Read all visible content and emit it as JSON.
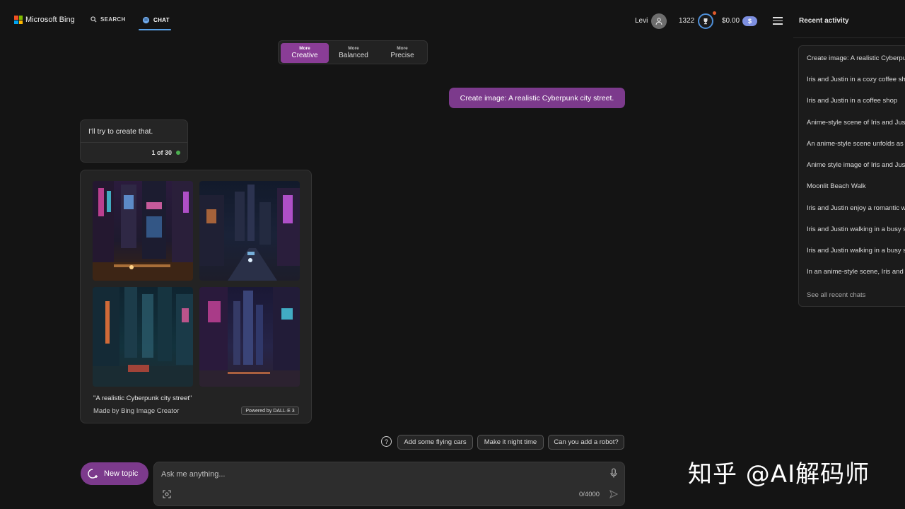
{
  "header": {
    "brand": "Microsoft Bing",
    "nav": [
      {
        "label": "SEARCH",
        "icon": "search-icon"
      },
      {
        "label": "CHAT",
        "icon": "chat-icon"
      }
    ],
    "user_name": "Levi",
    "points": "1322",
    "balance": "$0.00",
    "balance_badge": "$"
  },
  "recent": {
    "title": "Recent activity",
    "items": [
      "Create image: A realistic Cyberpunk city street.",
      "Iris and Justin in a cozy coffee shop",
      "Iris and Justin in a coffee shop",
      "Anime-style scene of Iris and Justin",
      "An anime-style scene unfolds as",
      "Anime style image of Iris and Justin",
      "Moonlit Beach Walk",
      "Iris and Justin enjoy a romantic walk",
      "Iris and Justin walking in a busy street",
      "Iris and Justin walking in a busy street",
      "In an anime-style scene, Iris and Justin"
    ],
    "see_all": "See all recent chats"
  },
  "tones": [
    {
      "small": "More",
      "label": "Creative",
      "active": true
    },
    {
      "small": "More",
      "label": "Balanced",
      "active": false
    },
    {
      "small": "More",
      "label": "Precise",
      "active": false
    }
  ],
  "conversation": {
    "user_message": "Create image: A realistic Cyberpunk city street.",
    "bot_message": "I'll try to create that.",
    "counter": "1 of 30"
  },
  "image_card": {
    "caption": "\"A realistic Cyberpunk city street\"",
    "made_by": "Made by Bing Image Creator",
    "powered_by": "Powered by DALL·E 3"
  },
  "suggestions": [
    "Add some flying cars",
    "Make it night time",
    "Can you add a robot?"
  ],
  "composer": {
    "new_topic": "New topic",
    "placeholder": "Ask me anything...",
    "char_count": "0/4000"
  },
  "watermark": "知乎 @AI解码师",
  "colors": {
    "accent_purple": "#7c3a8c",
    "background": "#141414",
    "status_green": "#4caf50"
  }
}
